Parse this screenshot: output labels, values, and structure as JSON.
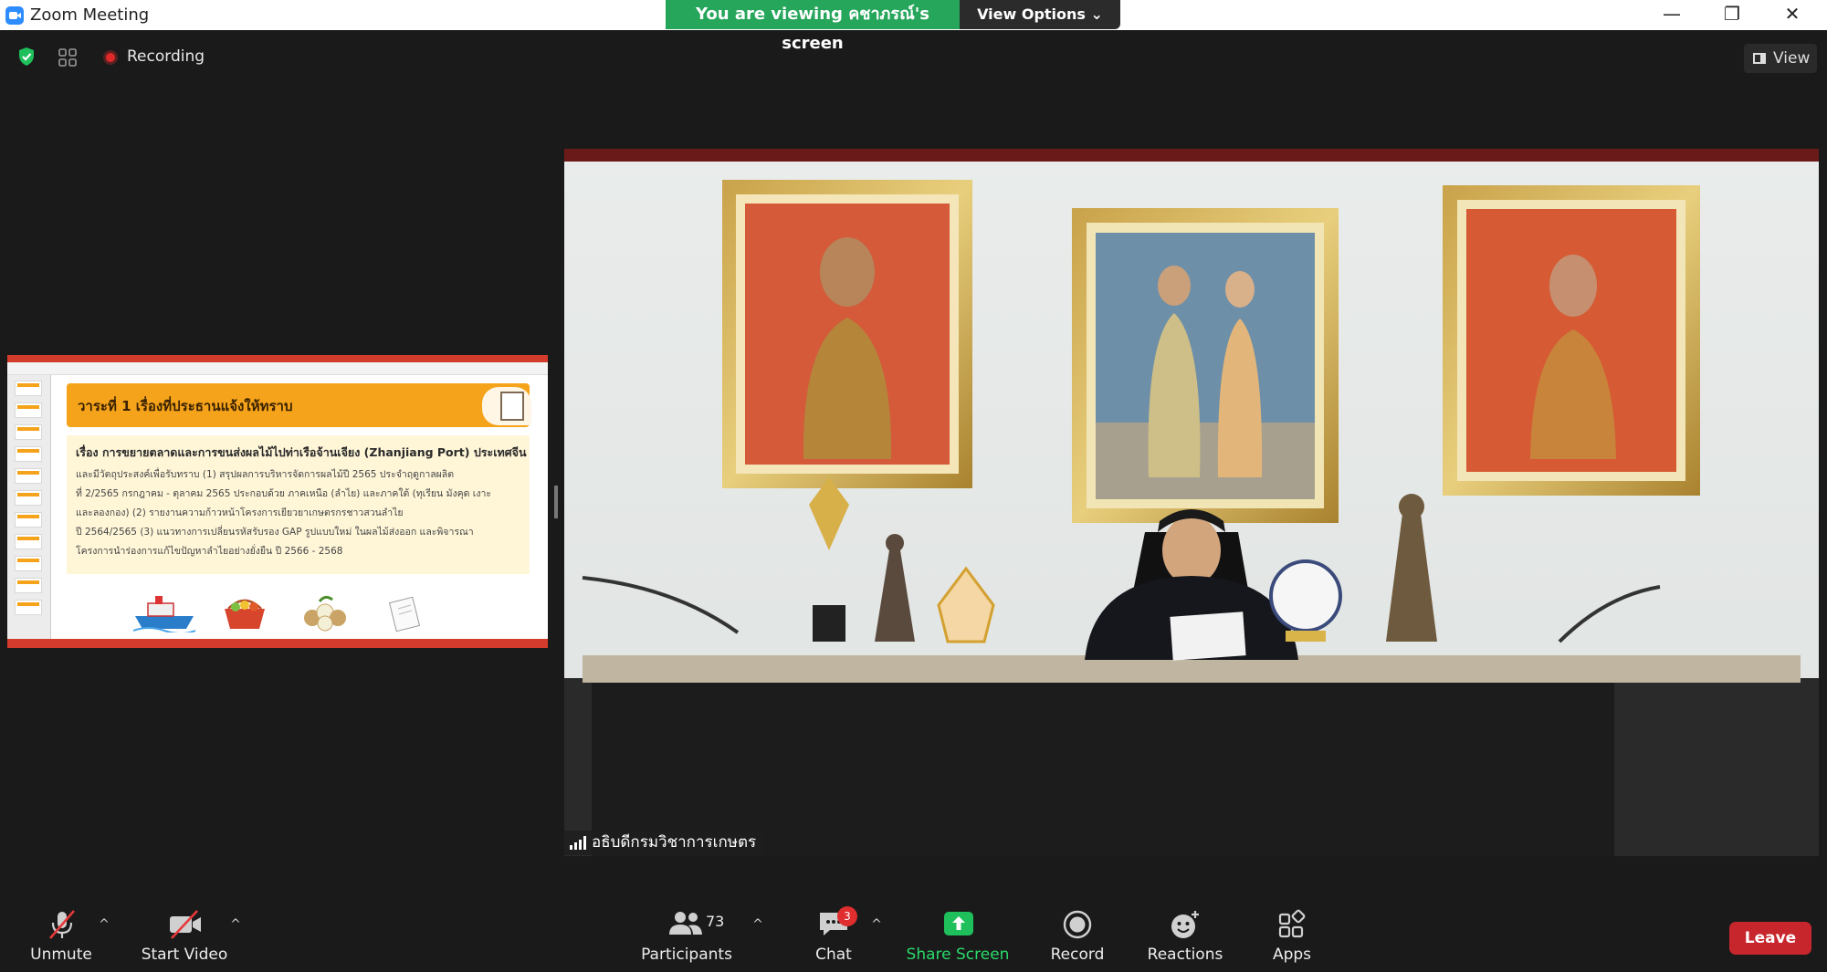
{
  "window": {
    "title": "Zoom Meeting",
    "minimize": "—",
    "restore": "❐",
    "close": "✕"
  },
  "share_banner": {
    "viewing_text": "You are viewing คชาภรณ์'s screen",
    "view_options_label": "View Options ⌄"
  },
  "top_bar": {
    "recording_label": "Recording",
    "view_label": "View"
  },
  "shared_screen": {
    "slide_title": "วาระที่ 1 เรื่องที่ประธานแจ้งให้ทราบ",
    "slide_subject": "เรื่อง การขยายตลาดและการขนส่งผลไม้ไปท่าเรือจ้านเจียง (Zhanjiang Port) ประเทศจีน",
    "slide_lines": [
      "และมีวัตถุประสงค์เพื่อรับทราบ (1) สรุปผลการบริหารจัดการผลไม้ปี 2565 ประจำฤดูกาลผลิต",
      "ที่ 2/2565 กรกฎาคม - ตุลาคม 2565 ประกอบด้วย ภาคเหนือ (ลำไย) และภาคใต้ (ทุเรียน มังคุด เงาะ",
      "และลองกอง) (2) รายงานความก้าวหน้าโครงการเยียวยาเกษตรกรชาวสวนลำไย",
      "ปี 2564/2565 (3) แนวทางการเปลี่ยนรหัสรับรอง GAP รูปแบบใหม่ ในผลไม้ส่งออก และพิจารณา",
      "โครงการนำร่องการแก้ไขปัญหาลำไยอย่างยั่งยืน ปี 2566 - 2568"
    ]
  },
  "video": {
    "speaker_name": "อธิบดีกรมวิชาการเกษตร"
  },
  "toolbar": {
    "unmute_label": "Unmute",
    "start_video_label": "Start Video",
    "participants_label": "Participants",
    "participants_count": "73",
    "chat_label": "Chat",
    "chat_badge": "3",
    "share_screen_label": "Share Screen",
    "record_label": "Record",
    "reactions_label": "Reactions",
    "apps_label": "Apps",
    "leave_label": "Leave"
  },
  "colors": {
    "background": "#1a1a1a",
    "share_green": "#26a65b",
    "leave_red": "#c8262d",
    "recording_red": "#e02828",
    "slide_orange": "#f5a31a"
  }
}
